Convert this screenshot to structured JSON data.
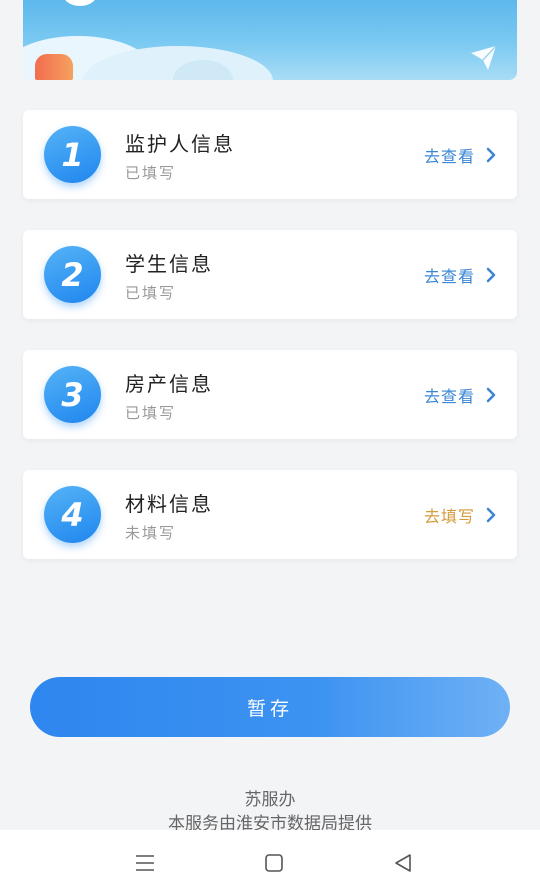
{
  "cards": [
    {
      "number": "1",
      "title": "监护人信息",
      "status": "已填写",
      "action": "去查看"
    },
    {
      "number": "2",
      "title": "学生信息",
      "status": "已填写",
      "action": "去查看"
    },
    {
      "number": "3",
      "title": "房产信息",
      "status": "已填写",
      "action": "去查看"
    },
    {
      "number": "4",
      "title": "材料信息",
      "status": "未填写",
      "action": "去填写"
    }
  ],
  "save_button": "暂存",
  "footer": {
    "service_name": "苏服办",
    "provider": "本服务由淮安市数据局提供"
  },
  "colors": {
    "accent": "#2e86ef",
    "view_action": "#3b86d6",
    "fill_action": "#d49a3c"
  },
  "icons": [
    "paper-plane-icon",
    "chevron-right-icon",
    "menu-icon",
    "home-icon",
    "back-icon"
  ]
}
